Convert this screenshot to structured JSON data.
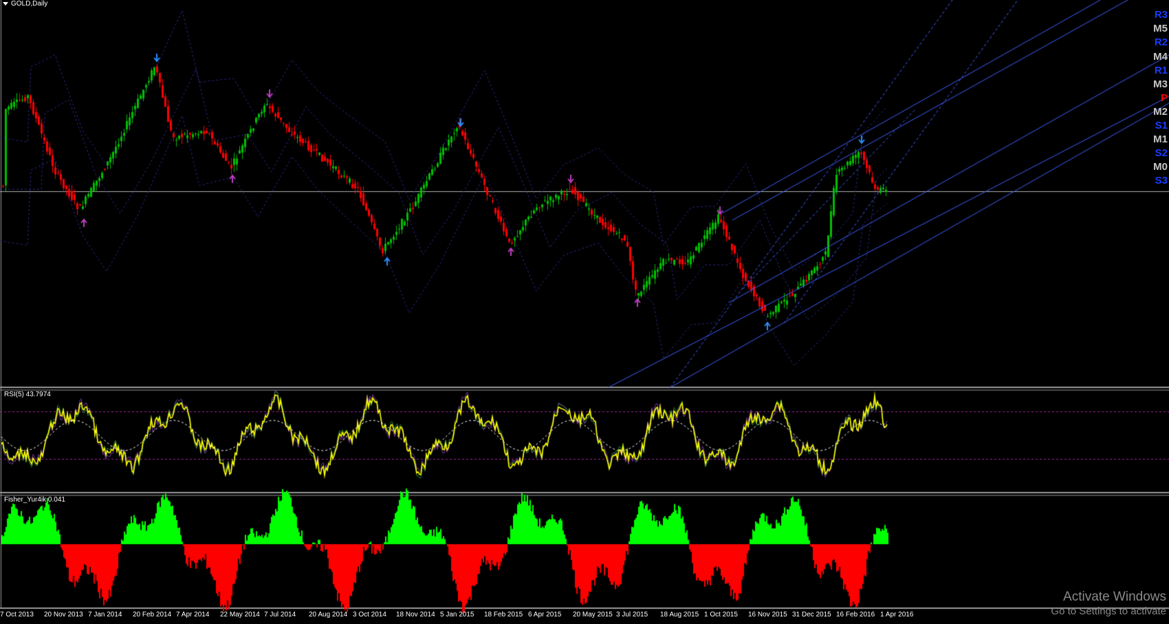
{
  "window": {
    "title": "GOLD,Daily"
  },
  "colors": {
    "background": "#000000",
    "bull": "#00c000",
    "bear": "#ff0000",
    "rsi": "#ffff00",
    "channel": "#4060ff",
    "fisher_pos": "#00ff00",
    "fisher_neg": "#ff0000",
    "pivot_resistance": "#1a3cff",
    "pivot_mid": "#c8c8c8",
    "pivot_p": "#ff0000"
  },
  "indicators": {
    "rsi_label": "RSI(5) 43.7974",
    "fisher_label": "Fisher_Yur4ik 0.041"
  },
  "pivot_levels": [
    "R3",
    "M5",
    "R2",
    "M4",
    "R1",
    "M3",
    "P",
    "M2",
    "S1",
    "M1",
    "S2",
    "M0",
    "S3"
  ],
  "date_axis": [
    "7 Oct 2013",
    "20 Nov 2013",
    "7 Jan 2014",
    "20 Feb 2014",
    "7 Apr 2014",
    "22 May 2014",
    "7 Jul 2014",
    "20 Aug 2014",
    "3 Oct 2014",
    "18 Nov 2014",
    "5 Jan 2015",
    "18 Feb 2015",
    "6 Apr 2015",
    "20 May 2015",
    "3 Jul 2015",
    "18 Aug 2015",
    "1 Oct 2015",
    "16 Nov 2015",
    "31 Dec 2015",
    "16 Feb 2016",
    "1 Apr 2016"
  ],
  "watermark": {
    "line1": "Activate Windows",
    "line2": "Go to Settings to activate"
  }
}
